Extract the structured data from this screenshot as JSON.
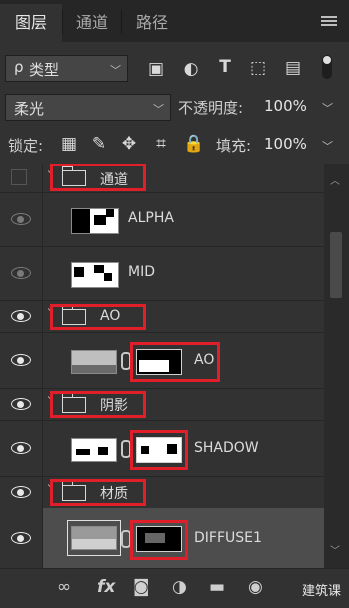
{
  "tabs": [
    {
      "label": "图层",
      "active": true
    },
    {
      "label": "通道",
      "active": false
    },
    {
      "label": "路径",
      "active": false
    }
  ],
  "filter": {
    "search_symbol": "ρ",
    "kind": "类型"
  },
  "blend": {
    "mode": "柔光",
    "opacity_label": "不透明度:",
    "opacity_value": "100%"
  },
  "lock": {
    "label": "锁定:",
    "fill_label": "填充:",
    "fill_value": "100%"
  },
  "layers": [
    {
      "name": "通道",
      "type": "group",
      "visible": false
    },
    {
      "name": "ALPHA",
      "type": "layer",
      "visible": false
    },
    {
      "name": "MID",
      "type": "layer",
      "visible": false
    },
    {
      "name": "AO",
      "type": "group",
      "visible": true
    },
    {
      "name": "AO",
      "type": "layer-mask",
      "visible": true
    },
    {
      "name": "阴影",
      "type": "group",
      "visible": true
    },
    {
      "name": "SHADOW",
      "type": "layer-mask",
      "visible": true
    },
    {
      "name": "材质",
      "type": "group",
      "visible": true
    },
    {
      "name": "DIFFUSE1",
      "type": "layer-mask",
      "visible": true,
      "selected": true
    }
  ],
  "watermark": "建筑课",
  "colors": {
    "panel": "#323232",
    "dark": "#262626",
    "highlight": "#e01f2b",
    "selected": "#4d4d4d"
  }
}
